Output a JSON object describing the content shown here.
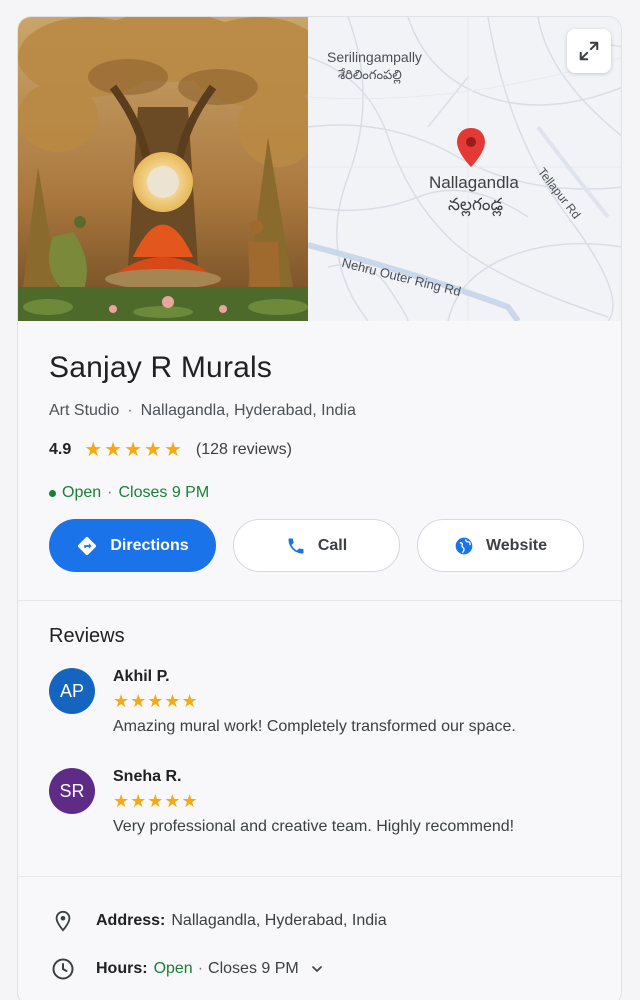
{
  "hero": {
    "map": {
      "area_label_en": "Serilingampally",
      "area_label_te": "శేరిలింగంపల్లి",
      "place_label_en": "Nallagandla",
      "place_label_te": "నల్లగండ్ల",
      "road_1": "Tellapur Rd",
      "road_2": "Nehru Outer Ring Rd",
      "pin_color": "#e53935"
    },
    "expand_icon": "expand-icon"
  },
  "business": {
    "name": "Sanjay R Murals",
    "category": "Art Studio",
    "separator": "·",
    "location": "Nallagandla, Hyderabad, India",
    "rating": "4.9",
    "stars": "★★★★★",
    "review_count": "(128 reviews)",
    "status": "Open",
    "status_sep": "·",
    "closes": "Closes 9 PM"
  },
  "actions": {
    "directions": "Directions",
    "call": "Call",
    "website": "Website"
  },
  "reviews": {
    "heading": "Reviews",
    "items": [
      {
        "initials": "AP",
        "name": "Akhil P.",
        "stars": "★★★★★",
        "text": "Amazing mural work! Completely transformed our space.",
        "avatar_color": "#1565c0"
      },
      {
        "initials": "SR",
        "name": "Sneha R.",
        "stars": "★★★★★",
        "text": "Very professional and creative team. Highly recommend!",
        "avatar_color": "#5e2b86"
      }
    ]
  },
  "details": {
    "address_label": "Address:",
    "address_value": "Nallagandla, Hyderabad, India",
    "hours_label": "Hours:",
    "hours_status": "Open",
    "hours_sep": "·",
    "hours_value": "Closes 9 PM"
  },
  "colors": {
    "accent": "#1a73e8",
    "open": "#188038",
    "star": "#f5ab0f"
  }
}
